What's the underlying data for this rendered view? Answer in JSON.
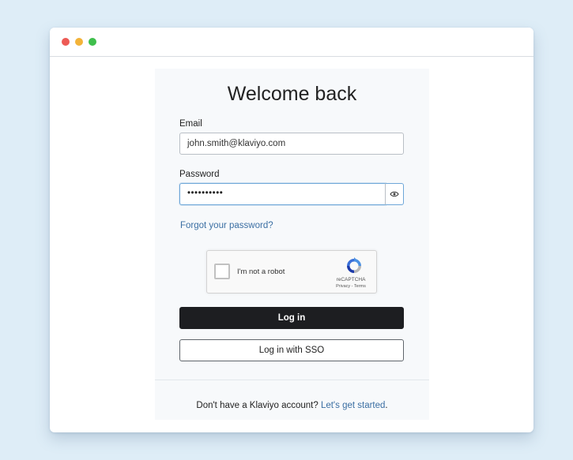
{
  "login": {
    "title": "Welcome back",
    "email_label": "Email",
    "email_value": "john.smith@klaviyo.com",
    "password_label": "Password",
    "password_value": "••••••••••",
    "forgot_link": "Forgot your password?",
    "login_button": "Log in",
    "sso_button": "Log in with SSO",
    "signup_prompt": "Don't have a Klaviyo account?",
    "signup_link": "Let's get started",
    "signup_suffix": "."
  },
  "recaptcha": {
    "checkbox_label": "I'm not a robot",
    "brand": "reCAPTCHA",
    "terms": "Privacy - Terms"
  },
  "icons": {
    "password_toggle": "eye-icon",
    "recaptcha_logo": "recaptcha-logo-icon"
  },
  "colors": {
    "background": "#deedf7",
    "primary_button": "#1d1e21",
    "link": "#3b6fa3",
    "focus_border": "#6ea7d8"
  }
}
